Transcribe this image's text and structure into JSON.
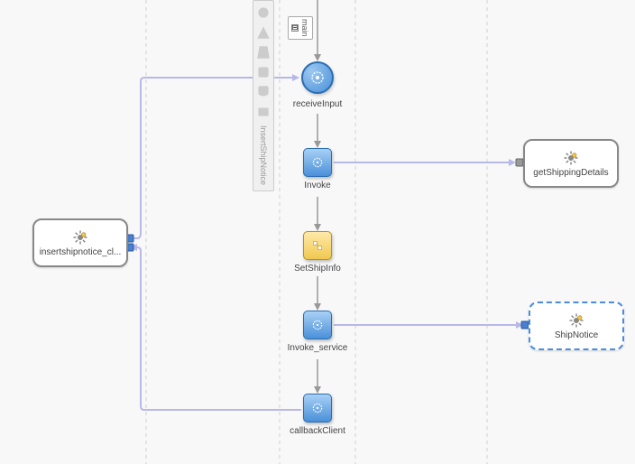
{
  "main_scope": {
    "toggle": "⊟",
    "label": "main"
  },
  "palette": {
    "label": "InsertShipNotice"
  },
  "nodes": {
    "receiveInput": {
      "label": "receiveInput"
    },
    "invoke": {
      "label": "Invoke"
    },
    "setShipInfo": {
      "label": "SetShipInfo"
    },
    "invokeService": {
      "label": "Invoke_service"
    },
    "callbackClient": {
      "label": "callbackClient"
    }
  },
  "partners": {
    "client": {
      "label": "insertshipnotice_cl..."
    },
    "getShippingDetails": {
      "label": "getShippingDetails"
    },
    "shipNotice": {
      "label": "ShipNotice"
    }
  }
}
